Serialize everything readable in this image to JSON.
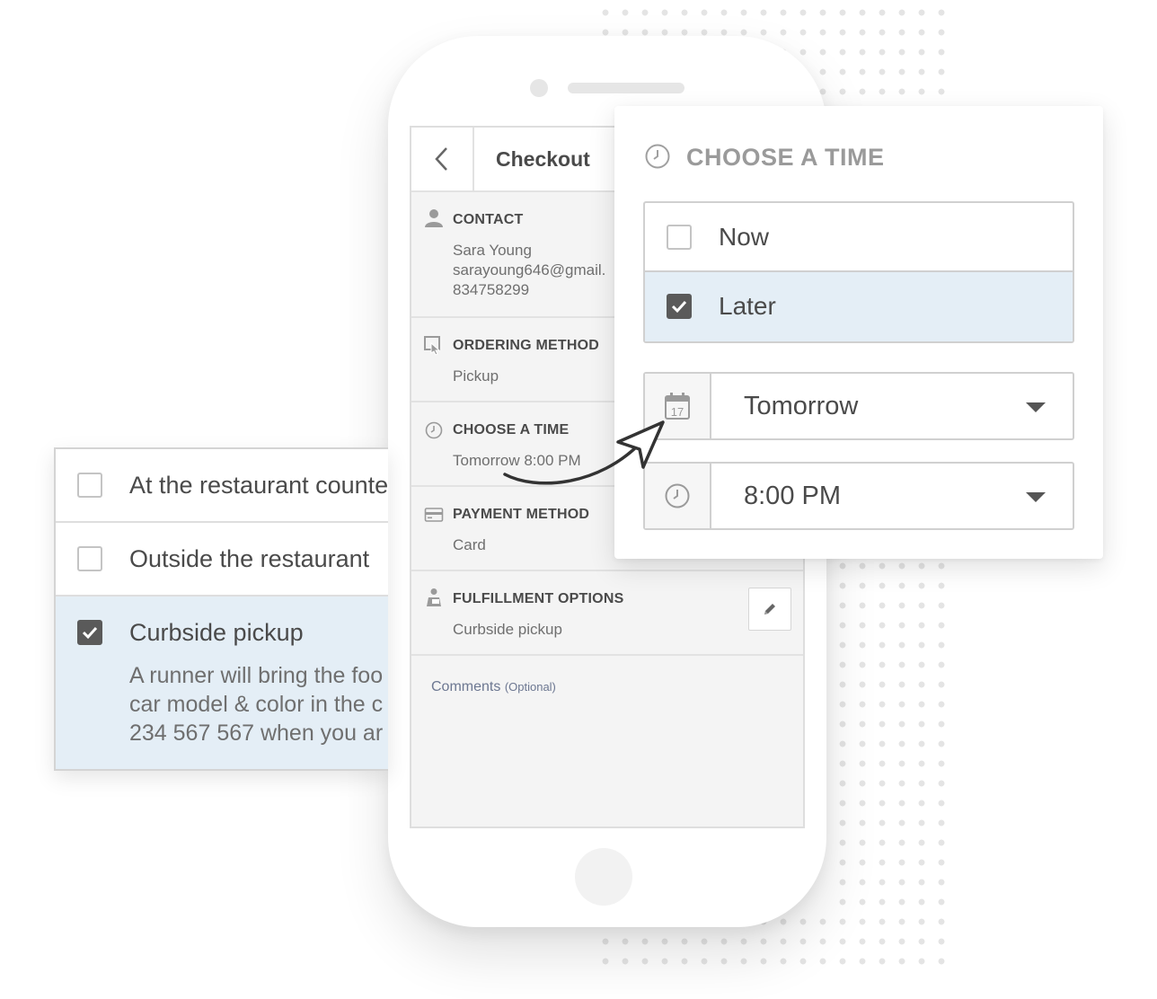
{
  "checkout": {
    "title": "Checkout",
    "sections": {
      "contact": {
        "title": "CONTACT",
        "name": "Sara Young",
        "email": "sarayoung646@gmail.",
        "phone": "834758299"
      },
      "ordering_method": {
        "title": "ORDERING METHOD",
        "value": "Pickup"
      },
      "choose_time": {
        "title": "CHOOSE A TIME",
        "value": "Tomorrow 8:00 PM"
      },
      "payment_method": {
        "title": "PAYMENT METHOD",
        "value": "Card"
      },
      "fulfillment": {
        "title": "FULFILLMENT OPTIONS",
        "value": "Curbside pickup"
      }
    },
    "comments": {
      "label": "Comments",
      "optional": "(Optional)"
    }
  },
  "fulfillment_card": {
    "options": [
      {
        "label": "At the restaurant counte",
        "checked": false
      },
      {
        "label": "Outside the restaurant",
        "checked": false
      },
      {
        "label": "Curbside pickup",
        "checked": true
      }
    ],
    "description_lines": [
      "A runner will bring the foo",
      "car model & color in the c",
      "234 567 567 when you ar"
    ]
  },
  "time_card": {
    "title": "CHOOSE A TIME",
    "options": [
      {
        "label": "Now",
        "checked": false
      },
      {
        "label": "Later",
        "checked": true
      }
    ],
    "day_select": {
      "value": "Tomorrow",
      "icon_day": "17"
    },
    "time_select": {
      "value": "8:00 PM"
    }
  },
  "colors": {
    "selected_bg": "#e4eef6",
    "checked_box": "#5a5a5a"
  }
}
